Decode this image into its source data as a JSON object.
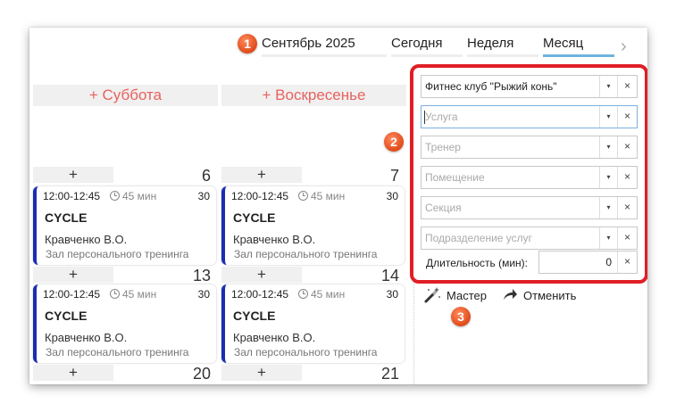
{
  "header": {
    "badge1": "1",
    "month": "Сентябрь 2025",
    "today": "Сегодня",
    "week": "Неделя",
    "month_view": "Месяц",
    "next_icon": "chevron-right-icon"
  },
  "days": {
    "saturday": "+ Суббота",
    "sunday": "+ Воскресенье"
  },
  "badge2": "2",
  "badge3": "3",
  "weeks": [
    {
      "plus": "+",
      "sat_num": "6",
      "sun_num": "7"
    },
    {
      "plus": "+",
      "sat_num": "13",
      "sun_num": "14"
    },
    {
      "plus": "+",
      "sat_num": "20",
      "sun_num": "21"
    }
  ],
  "event": {
    "time": "12:00-12:45",
    "duration": "45 мин",
    "capacity": "30",
    "title": "CYCLE",
    "trainer": "Кравченко В.О.",
    "room": "Зал персонального тренинга"
  },
  "filters": {
    "club": "Фитнес клуб \"Рыжий конь\"",
    "service_placeholder": "Услуга",
    "trainer_placeholder": "Тренер",
    "room_placeholder": "Помещение",
    "section_placeholder": "Секция",
    "division_placeholder": "Подразделение услуг",
    "caret": "▾",
    "clear": "×",
    "duration_label": "Длительность (мин):",
    "duration_value": "0"
  },
  "actions": {
    "wizard": "Мастер",
    "cancel": "Отменить"
  },
  "colors": {
    "accent_red": "#e01e26",
    "event_bar": "#1a2db3",
    "day_header_text": "#e8625e",
    "active_tab": "#6fb3dc"
  }
}
